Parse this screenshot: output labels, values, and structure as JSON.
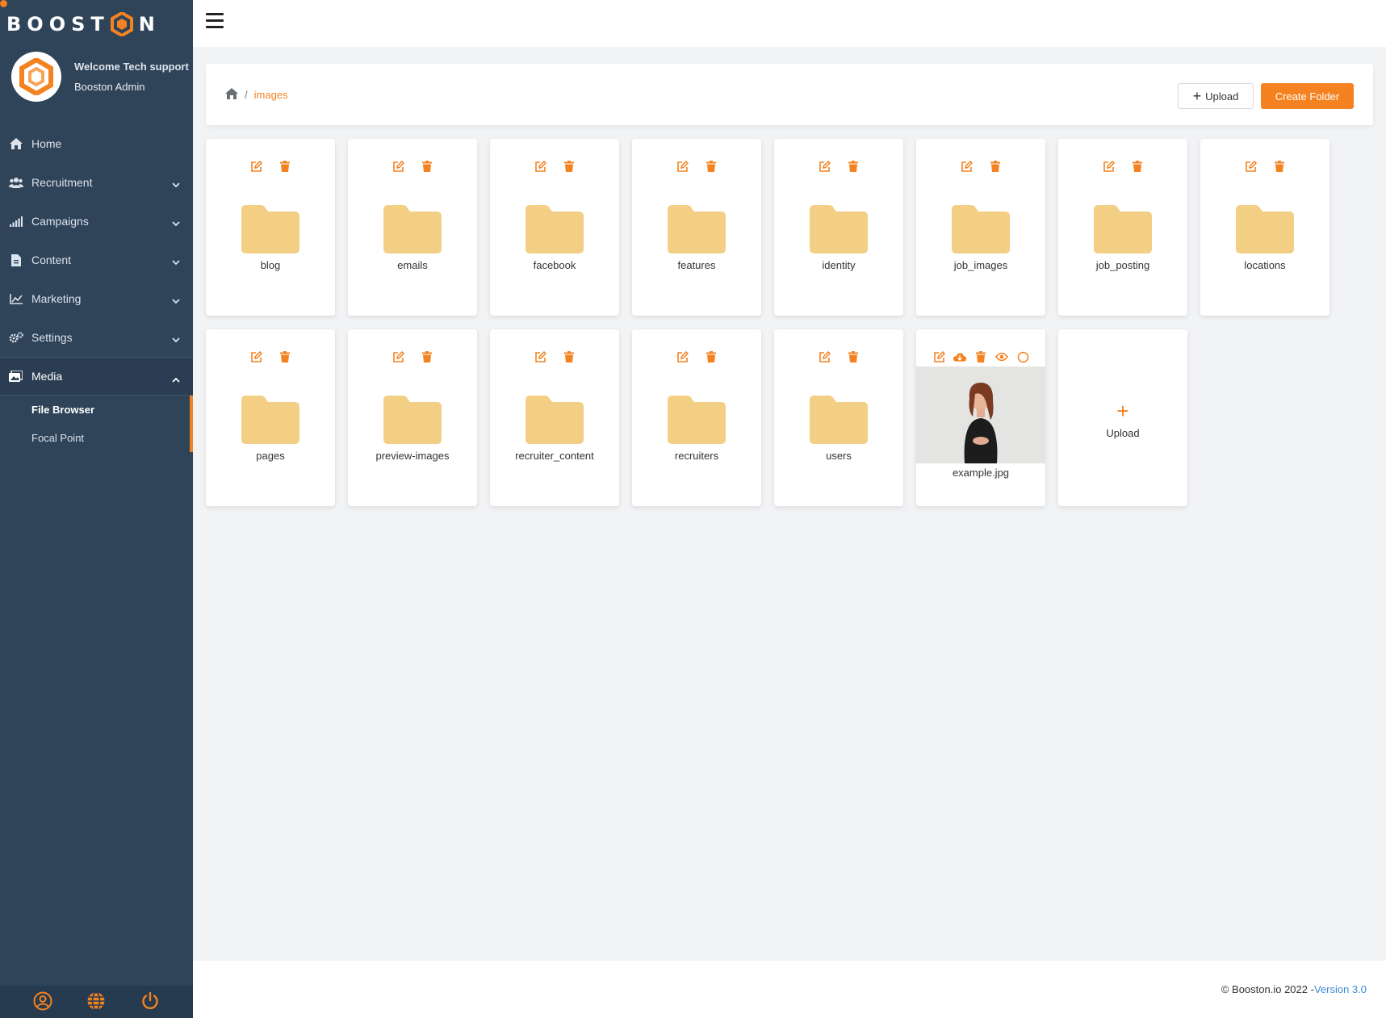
{
  "brand": {
    "text_left": "BOOST",
    "text_right": "N"
  },
  "profile": {
    "welcome": "Welcome Tech support",
    "role": "Booston Admin"
  },
  "nav": {
    "home": "Home",
    "recruitment": "Recruitment",
    "campaigns": "Campaigns",
    "content": "Content",
    "marketing": "Marketing",
    "settings": "Settings",
    "media": "Media",
    "sub": {
      "file_browser": "File Browser",
      "focal_point": "Focal Point"
    }
  },
  "breadcrumb": {
    "separator": "/",
    "current": "images"
  },
  "toolbar": {
    "upload_plus": "+",
    "upload_label": "Upload",
    "create_folder_label": "Create Folder"
  },
  "folders": [
    "blog",
    "emails",
    "facebook",
    "features",
    "identity",
    "job_images",
    "job_posting",
    "locations",
    "pages",
    "preview-images",
    "recruiter_content",
    "recruiters",
    "users"
  ],
  "image_file": {
    "name": "example.jpg"
  },
  "upload_tile": {
    "plus": "+",
    "label": "Upload"
  },
  "footer": {
    "copyright": "© Booston.io 2022 -",
    "version": "Version 3.0"
  },
  "colors": {
    "accent": "#f58220",
    "sidebar": "#2f4359",
    "folder": "#f2cf85",
    "version_link": "#3d8ad6"
  }
}
